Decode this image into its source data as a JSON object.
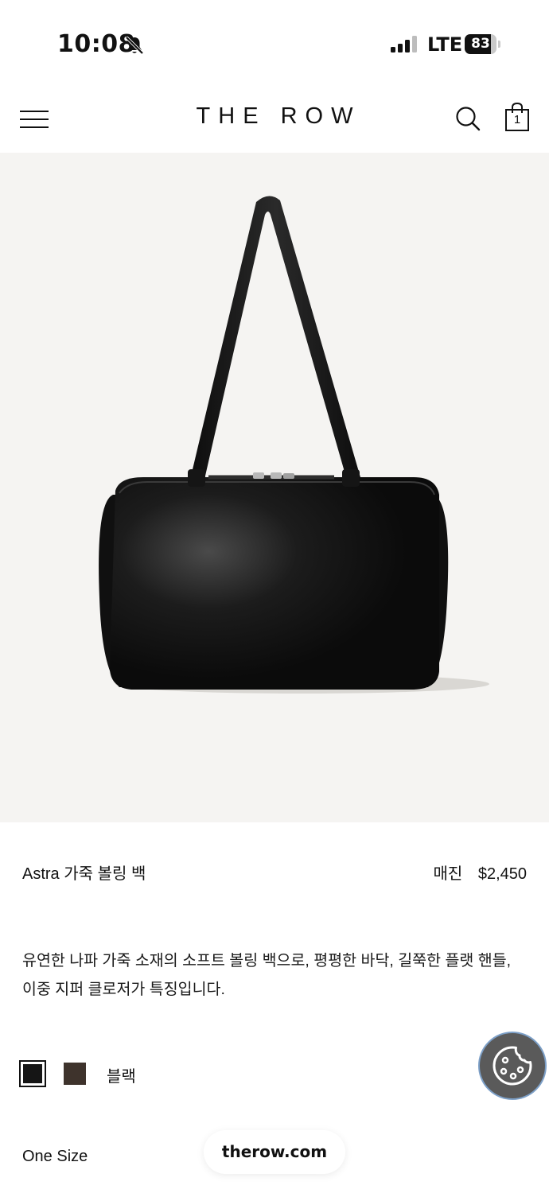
{
  "status_bar": {
    "time": "10:08",
    "network": "LTE",
    "battery_level": "83",
    "battery_fraction": 0.83
  },
  "header": {
    "brand": "THE ROW",
    "cart_count": "1",
    "icons": [
      "menu-icon",
      "search-icon",
      "bag-icon"
    ]
  },
  "product": {
    "image_alt_icon": "shoulder-bag-image",
    "title": "Astra 가죽 볼링 백",
    "availability": "매진",
    "price": "$2,450",
    "description": "유연한 나파 가죽 소재의 소프트 볼링 백으로, 평평한 바닥, 길쭉한 플랫 핸들, 이중 지퍼 클로저가 특징입니다.",
    "colors": [
      {
        "name": "블랙",
        "hex": "#151515",
        "selected": true
      },
      {
        "name": "brown",
        "hex": "#3e332c",
        "selected": false
      }
    ],
    "selected_color_label": "블랙",
    "size": "One Size"
  },
  "browser": {
    "url": "therow.com"
  },
  "colors": {
    "image_background": "#f5f4f2",
    "cookie_button": "#5a5a5a",
    "cookie_border": "#7da0c8"
  }
}
